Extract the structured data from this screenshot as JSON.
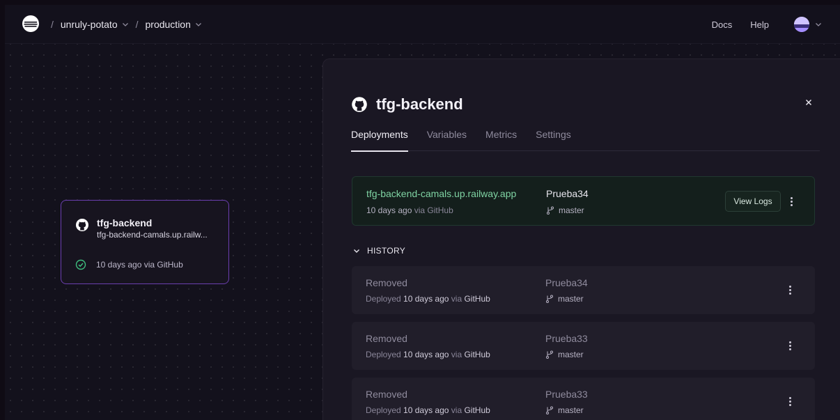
{
  "breadcrumb": {
    "project": "unruly-potato",
    "environment": "production",
    "separator": "/"
  },
  "topnav": {
    "docs": "Docs",
    "help": "Help"
  },
  "canvas": {
    "service_card": {
      "name": "tfg-backend",
      "url": "tfg-backend-camals.up.railw...",
      "status": "10 days ago via GitHub"
    }
  },
  "panel": {
    "title": "tfg-backend",
    "close": "×",
    "tabs": [
      "Deployments",
      "Variables",
      "Metrics",
      "Settings"
    ],
    "active_deployment": {
      "url": "tfg-backend-camals.up.railway.app",
      "time": "10 days ago",
      "via": "via GitHub",
      "commit": "Prueba34",
      "branch": "master",
      "view_logs": "View Logs"
    },
    "history_label": "HISTORY",
    "history": [
      {
        "status": "Removed",
        "prefix": "Deployed",
        "time": "10 days ago",
        "via": "via",
        "source": "GitHub",
        "commit": "Prueba34",
        "branch": "master"
      },
      {
        "status": "Removed",
        "prefix": "Deployed",
        "time": "10 days ago",
        "via": "via",
        "source": "GitHub",
        "commit": "Prueba33",
        "branch": "master"
      },
      {
        "status": "Removed",
        "prefix": "Deployed",
        "time": "10 days ago",
        "via": "via",
        "source": "GitHub",
        "commit": "Prueba33",
        "branch": "master"
      }
    ]
  },
  "colors": {
    "accent_green": "#7fd3a3",
    "card_border": "#6b3fb0",
    "background": "#13111c"
  }
}
